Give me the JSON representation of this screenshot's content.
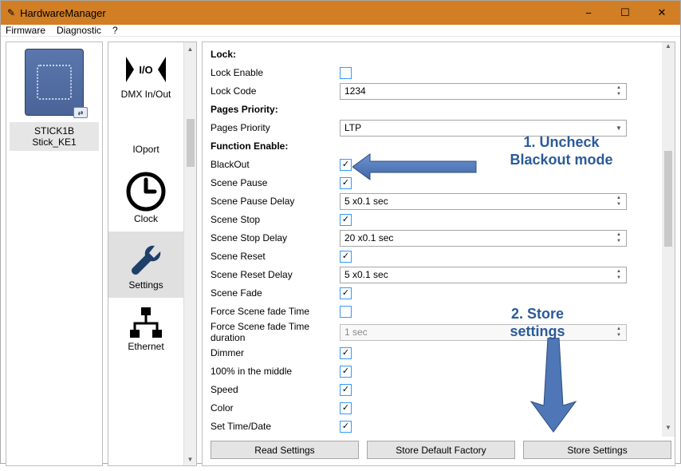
{
  "window": {
    "title": "HardwareManager"
  },
  "menu": {
    "firmware": "Firmware",
    "diagnostic": "Diagnostic",
    "help": "?"
  },
  "device": {
    "line1": "STICK1B",
    "line2": "Stick_KE1"
  },
  "nav": {
    "items": [
      {
        "label": "DMX In/Out"
      },
      {
        "label": "IOport"
      },
      {
        "label": "Clock"
      },
      {
        "label": "Settings"
      },
      {
        "label": "Ethernet"
      }
    ]
  },
  "settings": {
    "section_lock": "Lock:",
    "lock_enable": "Lock Enable",
    "lock_code": "Lock Code",
    "lock_code_value": "1234",
    "section_pages": "Pages Priority:",
    "pages_priority": "Pages Priority",
    "pages_priority_value": "LTP",
    "section_func": "Function Enable:",
    "blackout": "BlackOut",
    "scene_pause": "Scene Pause",
    "scene_pause_delay": "Scene Pause Delay",
    "scene_pause_delay_value": "5 x0.1 sec",
    "scene_stop": "Scene Stop",
    "scene_stop_delay": "Scene Stop Delay",
    "scene_stop_delay_value": "20 x0.1 sec",
    "scene_reset": "Scene Reset",
    "scene_reset_delay": "Scene Reset Delay",
    "scene_reset_delay_value": "5 x0.1 sec",
    "scene_fade": "Scene Fade",
    "force_fade": "Force Scene fade Time",
    "force_fade_dur": "Force Scene fade Time duration",
    "force_fade_dur_value": "1 sec",
    "dimmer": "Dimmer",
    "hundred": "100% in the middle",
    "speed": "Speed",
    "color": "Color",
    "set_time": "Set Time/Date"
  },
  "buttons": {
    "read": "Read Settings",
    "store_default": "Store Default Factory",
    "store": "Store Settings"
  },
  "annotations": {
    "a1": "1. Uncheck\nBlackout mode",
    "a2": "2. Store\nsettings"
  }
}
